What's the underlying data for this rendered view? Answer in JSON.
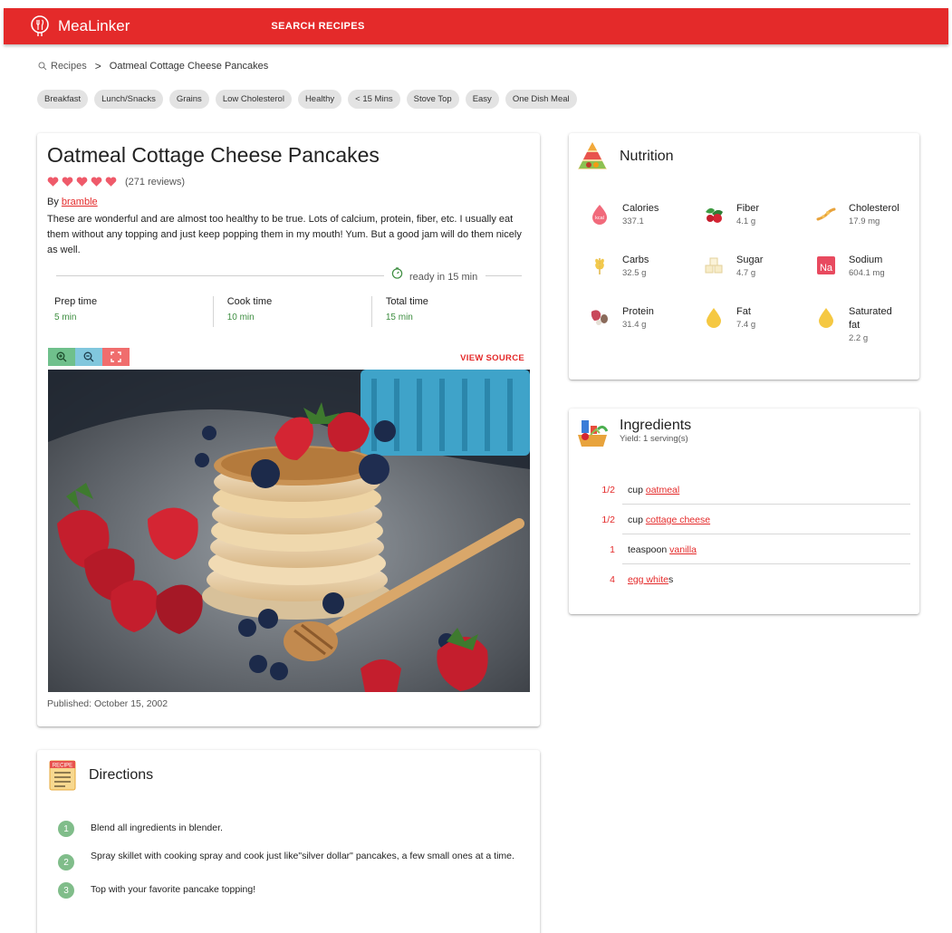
{
  "app": {
    "brand": "MeaLinker",
    "nav_search": "SEARCH RECIPES"
  },
  "breadcrumb": {
    "root": "Recipes",
    "separator": ">",
    "current": "Oatmeal Cottage Cheese Pancakes"
  },
  "tags": [
    "Breakfast",
    "Lunch/Snacks",
    "Grains",
    "Low Cholesterol",
    "Healthy",
    "< 15 Mins",
    "Stove Top",
    "Easy",
    "One Dish Meal"
  ],
  "recipe": {
    "title": "Oatmeal Cottage Cheese Pancakes",
    "rating": 5,
    "reviews": "(271 reviews)",
    "author_prefix": "By",
    "author": "bramble",
    "description": "These are wonderful and are almost too healthy to be true. Lots of calcium, protein, fiber, etc. I usually eat them without any topping and just keep popping them in my mouth! Yum. But a good jam will do them nicely as well.",
    "ready_text": "ready in 15 min",
    "times": [
      {
        "label": "Prep time",
        "value": "5 min"
      },
      {
        "label": "Cook time",
        "value": "10 min"
      },
      {
        "label": "Total time",
        "value": "15 min"
      }
    ],
    "view_source": "VIEW SOURCE",
    "published": "Published: October 15, 2002"
  },
  "nutrition": {
    "title": "Nutrition",
    "items": [
      {
        "name": "Calories",
        "value": "337.1",
        "icon": "calories-icon"
      },
      {
        "name": "Fiber",
        "value": "4.1 g",
        "icon": "fiber-icon"
      },
      {
        "name": "Cholesterol",
        "value": "17.9 mg",
        "icon": "cholesterol-icon"
      },
      {
        "name": "Carbs",
        "value": "32.5 g",
        "icon": "carbs-icon"
      },
      {
        "name": "Sugar",
        "value": "4.7 g",
        "icon": "sugar-icon"
      },
      {
        "name": "Sodium",
        "value": "604.1 mg",
        "icon": "sodium-icon"
      },
      {
        "name": "Protein",
        "value": "31.4 g",
        "icon": "protein-icon"
      },
      {
        "name": "Fat",
        "value": "7.4 g",
        "icon": "fat-icon"
      },
      {
        "name": "Saturated fat",
        "value": "2.2 g",
        "icon": "saturated-fat-icon"
      }
    ],
    "sodium_symbol": "Na",
    "calories_symbol": "kcal"
  },
  "ingredients": {
    "title": "Ingredients",
    "yield": "Yield: 1 serving(s)",
    "items": [
      {
        "qty": "1/2",
        "unit": "cup",
        "name": "oatmeal",
        "suffix": ""
      },
      {
        "qty": "1/2",
        "unit": "cup",
        "name": "cottage cheese",
        "suffix": ""
      },
      {
        "qty": "1",
        "unit": "teaspoon",
        "name": "vanilla",
        "suffix": ""
      },
      {
        "qty": "4",
        "unit": "",
        "name": "egg white",
        "suffix": "s"
      }
    ]
  },
  "directions": {
    "title": "Directions",
    "icon_label": "RECIPE",
    "steps": [
      {
        "num": "1",
        "text": "Blend all ingredients in blender."
      },
      {
        "num": "2",
        "text": "Spray skillet with cooking spray and cook just like\"silver dollar\" pancakes, a few small ones at a time."
      },
      {
        "num": "3",
        "text": "Top with your favorite pancake topping!"
      }
    ]
  },
  "colors": {
    "primary": "#e42a2a",
    "accent_green": "#3e8e41",
    "step_green": "#80bd8a"
  }
}
